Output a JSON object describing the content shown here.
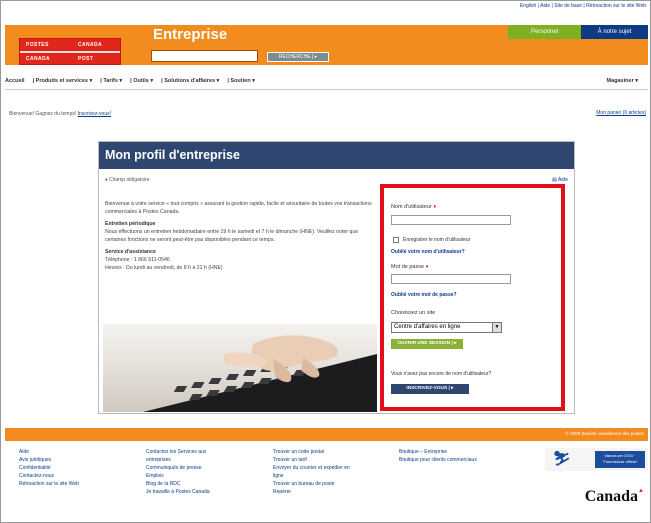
{
  "top_links": "English | Aide | Site de base | Rétroaction sur le site Web",
  "brand": {
    "logo_line1_left": "POSTES",
    "logo_line1_right": "CANADA",
    "logo_line2_left": "CANADA",
    "logo_line2_right": "POST",
    "title": "Entreprise",
    "search_button": "RECHERCHE | ▸",
    "tab_personal": "Personnel",
    "tab_about": "À notre sujet"
  },
  "nav": {
    "items": [
      "Accueil",
      "Produits et services ▾",
      "Tarifs ▾",
      "Outils ▾",
      "Solutions d'affaires ▾",
      "Soutien ▾"
    ],
    "right": "Magasiner ▾"
  },
  "welcome": {
    "text": "Bienvenue! Gagnez du temps!",
    "link": "Inscrivez-vous!",
    "cart": "Mon panier (0 articles)"
  },
  "panel": {
    "title": "Mon profil d'entreprise",
    "required": "Champ obligatoire",
    "help": "Aide",
    "intro": "Bienvenue à votre service « tout compris » assurant la gestion rapide, facile et sécuritaire de toutes vos transactions commerciales à Postes Canada.",
    "maintenance_title": "Entretien périodique",
    "maintenance_text": "Nous effectuons un entretien hebdomadaire entre 19 h le samedi et 7 h le dimanche (HNE). Veuillez noter que certaines fonctions ne seront peut-être pas disponibles pendant ce temps.",
    "support_title": "Service d'assistance",
    "support_phone": "Téléphone : 1 866 511-0546",
    "support_hours": "Heures : Du lundi au vendredi, de 8 h à 21 h (HNE)"
  },
  "login": {
    "username_label": "Nom d'utilisateur",
    "remember_label": "Enregistrer le nom d'utilisateur",
    "forgot_username": "Oublié votre nom d'utilisateur?",
    "password_label": "Mot de passe",
    "forgot_password": "Oublié votre mot de passe?",
    "site_label": "Choisissez un site",
    "site_value": "Centre d'affaires en ligne",
    "open_session": "OUVRIR UNE SESSION | ▸",
    "no_user_question": "Vous n'avez pas encore de nom d'utilisateur?",
    "register": "INSCRIVEZ-VOUS | ▸"
  },
  "footer": {
    "copyright": "© 2009 Société canadienne des postes",
    "col1": [
      "Aide",
      "Avis juridiques",
      "Confidentialité",
      "Contactez-nous",
      "Rétroaction sur le site Web"
    ],
    "col2": [
      "Contactez les Services aux",
      "entreprises",
      "Communiqués de presse",
      "Emplois",
      "Blog de la RDC",
      "Je travaille à Postes Canada"
    ],
    "col3": [
      "Trouver un code postal",
      "Trouver un tarif",
      "Envoyer du courrier et expédier en",
      "ligne",
      "Trouver un bureau de poste",
      "Repérer"
    ],
    "col4": [
      "Boutique – Entreprise",
      "Boutique pour clients commerciaux"
    ],
    "olympic_text": "Vancouver 2010 · Fournisseur officiel",
    "wordmark": "Canada"
  },
  "colors": {
    "orange": "#f28c1e",
    "canada_post_red": "#e1261c",
    "navy": "#2e4670",
    "green": "#8ab237",
    "highlight": "#e0101a"
  }
}
